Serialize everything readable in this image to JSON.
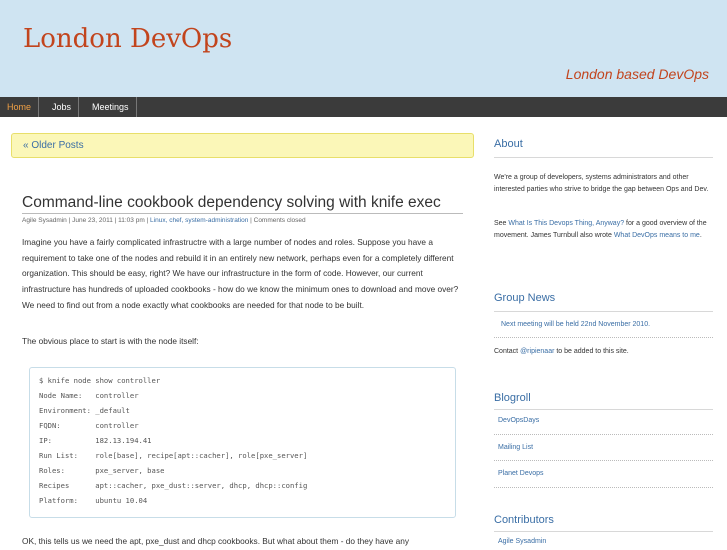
{
  "site": {
    "title": "London DevOps",
    "tagline": "London based DevOps"
  },
  "nav": {
    "items": [
      "Home",
      "Jobs",
      "Meetings"
    ],
    "active": "Home"
  },
  "older_posts": "« Older Posts",
  "post": {
    "title": "Command-line cookbook dependency solving with knife exec",
    "meta_prefix": "Agile Sysadmin | June 23, 2011 | 11:03 pm | ",
    "meta_tags": "Linux, chef, system-administration",
    "meta_sep": " | ",
    "meta_comments": "Comments closed",
    "paragraphs": [
      "Imagine you have a fairly complicated infrastructre with a large number of nodes and roles. Suppose you have a requirement to take one of the nodes and rebuild it in an entirely new network, perhaps even for a completely different organization. This should be easy, right? We have our infrastructure in the form of code. However, our current infrastructure has hundreds of uploaded cookbooks - how do we know the minimum ones to download and move over? We need to find out from a node exactly what cookbooks are needed for that node to be built.",
      "The obvious place to start is with the node itself:",
      "OK, this tells us we need the apt, pxe_dust and dhcp cookbooks. But what about them - do they have any"
    ],
    "code_lines": [
      "$ knife node show controller",
      "Node Name:   controller",
      "Environment: _default",
      "FQDN:        controller",
      "IP:          182.13.194.41",
      "Run List:    role[base], recipe[apt::cacher], role[pxe_server]",
      "Roles:       pxe_server, base",
      "Recipes      apt::cacher, pxe_dust::server, dhcp, dhcp::config",
      "Platform:    ubuntu 10.04"
    ]
  },
  "sidebar": {
    "about": {
      "heading": "About",
      "text1": "We're a group of developers, systems administrators and other interested parties who strive to bridge the gap between Ops and Dev.",
      "see": "See ",
      "link1": "What Is This Devops Thing, Anyway?",
      "mid": " for a good overview of the movement. James Turnbull also wrote ",
      "link2": "What DevOps means to me",
      "end": "."
    },
    "group_news": {
      "heading": "Group News",
      "item": "Next meeting will be held 22nd November 2010.",
      "contact_pre": "Contact ",
      "contact_link": "@ripienaar",
      "contact_post": " to be added to this site."
    },
    "blogroll": {
      "heading": "Blogroll",
      "items": [
        "DevOpsDays",
        "Mailing List",
        "Planet Devops"
      ]
    },
    "contributors": {
      "heading": "Contributors",
      "items": [
        "Agile Sysadmin"
      ]
    }
  },
  "colors": {
    "accent": "#c2441d",
    "link": "#3a6ea5",
    "header_bg": "#cfe4f2",
    "nav_bg": "#3b3b3b"
  }
}
